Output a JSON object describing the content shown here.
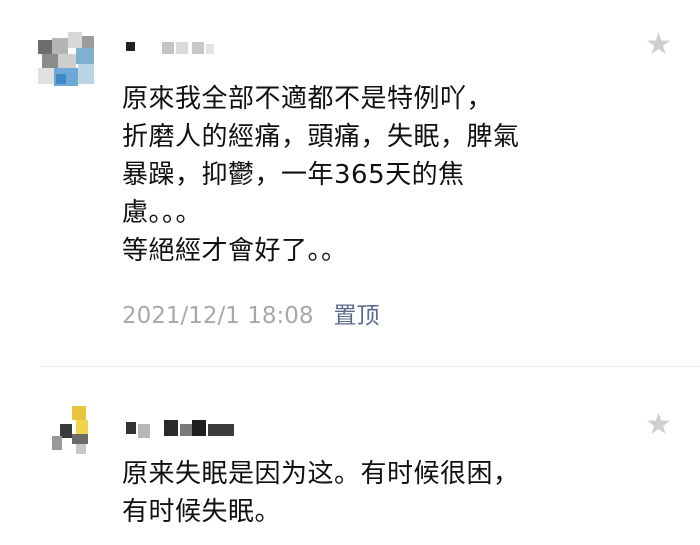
{
  "comments": [
    {
      "text": "原來我全部不適都不是特例吖，\n折磨人的經痛，頭痛，失眠，脾氣\n暴躁，抑鬱，一年365天的焦\n慮。。。\n等絕經才會好了。。",
      "timestamp": "2021/12/1 18:08",
      "pin_label": "置顶",
      "like_icon": "star-icon"
    },
    {
      "text": "原来失眠是因为这。有时候很困，\n有时候失眠。",
      "like_icon": "star-icon"
    }
  ]
}
